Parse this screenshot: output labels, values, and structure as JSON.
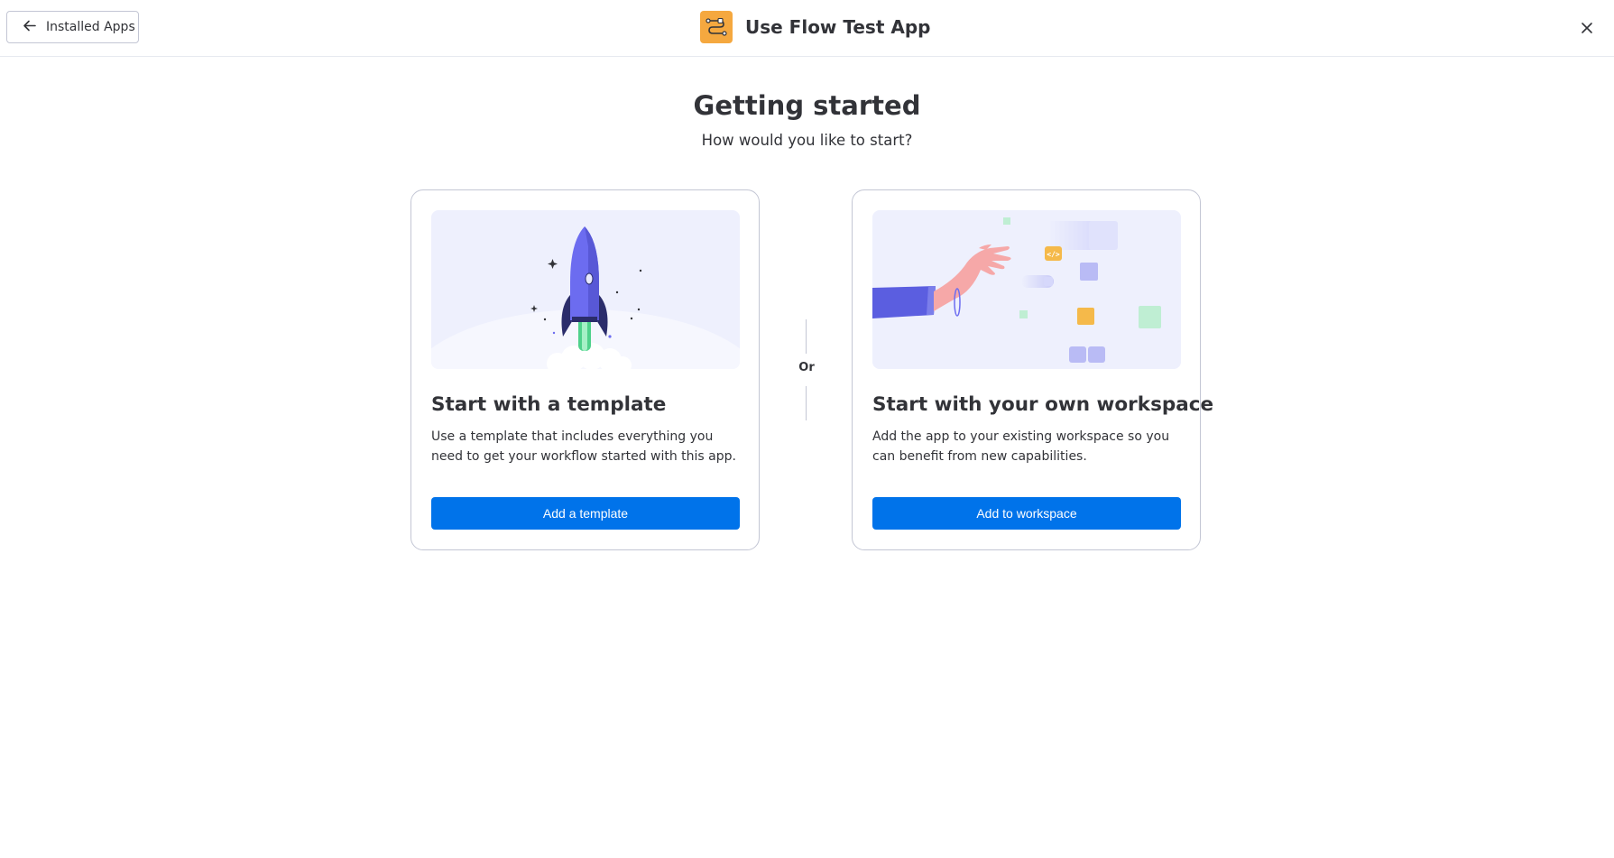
{
  "header": {
    "back_label": "Installed Apps",
    "app_title": "Use Flow Test App",
    "icons": {
      "back": "arrow-left-icon",
      "app": "flow-app-icon",
      "close": "close-icon"
    }
  },
  "main": {
    "heading": "Getting started",
    "subheading": "How would you like to start?",
    "divider_label": "Or",
    "cards": [
      {
        "title": "Start with a template",
        "description": "Use a template that includes everything you need to get your workflow started with this app.",
        "button_label": "Add a template",
        "illustration": "rocket-illustration"
      },
      {
        "title": "Start with your own workspace",
        "description": "Add the app to your existing workspace so you can benefit from new capabilities.",
        "button_label": "Add to workspace",
        "illustration": "hand-workspace-illustration"
      }
    ]
  },
  "colors": {
    "primary_button": "#0073ea",
    "app_icon_bg": "#f5a83f",
    "illustration_bg": "#eef0fd",
    "text": "#323338",
    "border": "#c3c6d4"
  }
}
